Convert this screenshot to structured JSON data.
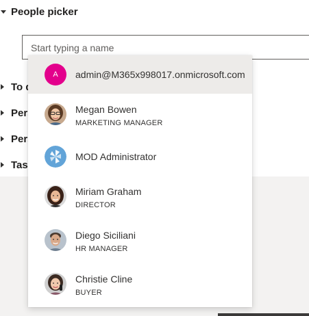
{
  "sections": [
    {
      "label": "People picker",
      "expanded": true
    },
    {
      "label": "To do",
      "expanded": false
    },
    {
      "label": "Person",
      "expanded": false
    },
    {
      "label": "Person card",
      "expanded": false
    },
    {
      "label": "Tasks",
      "expanded": false
    }
  ],
  "picker": {
    "placeholder": "Start typing a name",
    "value": ""
  },
  "suggestions": [
    {
      "initials": "A",
      "name": "admin@M365x998017.onmicrosoft.com",
      "title": "",
      "avatar": "initials-avatar",
      "color": "#e3008c",
      "selected": true
    },
    {
      "initials": "",
      "name": "Megan Bowen",
      "title": "MARKETING MANAGER",
      "avatar": "photo-avatar"
    },
    {
      "initials": "",
      "name": "MOD Administrator",
      "title": "",
      "avatar": "logo-avatar",
      "color": "#62a4d8"
    },
    {
      "initials": "",
      "name": "Miriam Graham",
      "title": "DIRECTOR",
      "avatar": "photo-avatar"
    },
    {
      "initials": "",
      "name": "Diego Siciliani",
      "title": "HR MANAGER",
      "avatar": "photo-avatar"
    },
    {
      "initials": "",
      "name": "Christie Cline",
      "title": "BUYER",
      "avatar": "photo-avatar"
    }
  ],
  "colors": {
    "accent_pink": "#e3008c",
    "selected_bg": "#edebe9",
    "page_gray": "#f3f2f1"
  }
}
